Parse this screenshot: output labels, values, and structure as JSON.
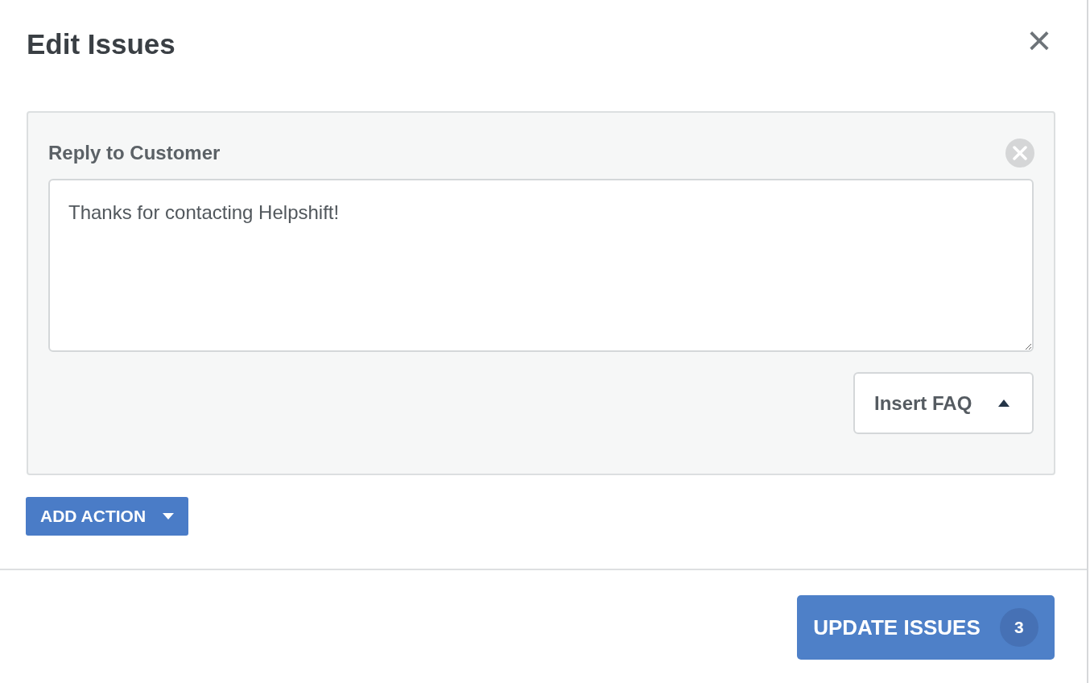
{
  "dialog": {
    "title": "Edit Issues",
    "close": "×"
  },
  "action_panel": {
    "title": "Reply to Customer",
    "message": "Thanks for contacting Helpshift!",
    "insert_button": "Insert FAQ"
  },
  "add_action_button": "ADD ACTION",
  "footer": {
    "update_button": "UPDATE ISSUES",
    "count": "3"
  }
}
